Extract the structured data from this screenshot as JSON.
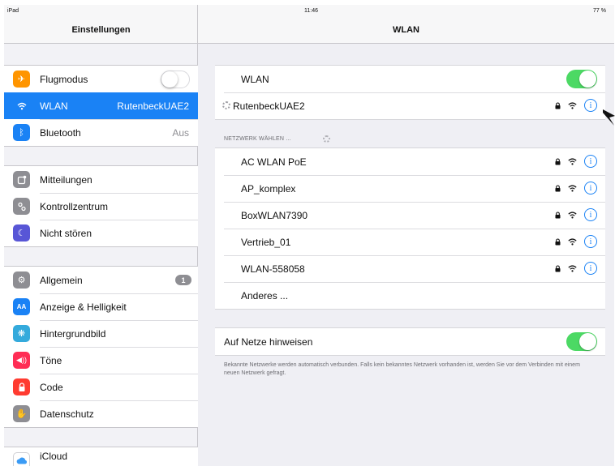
{
  "status": {
    "device": "iPad",
    "time": "11:46",
    "battery": "77 %"
  },
  "sidebar": {
    "title": "Einstellungen",
    "groups": [
      [
        {
          "label": "Flugmodus",
          "icon": "airplane-icon",
          "color": "#ff9500",
          "toggle": false
        },
        {
          "label": "WLAN",
          "icon": "wifi-icon",
          "color": "#1a82f5",
          "value": "RutenbeckUAE2",
          "selected": true
        },
        {
          "label": "Bluetooth",
          "icon": "bluetooth-icon",
          "color": "#1a82f5",
          "value": "Aus"
        }
      ],
      [
        {
          "label": "Mitteilungen",
          "icon": "notifications-icon",
          "color": "#8e8e93"
        },
        {
          "label": "Kontrollzentrum",
          "icon": "control-center-icon",
          "color": "#8e8e93"
        },
        {
          "label": "Nicht stören",
          "icon": "moon-icon",
          "color": "#5856d6"
        }
      ],
      [
        {
          "label": "Allgemein",
          "icon": "gear-icon",
          "color": "#8e8e93",
          "badge": "1"
        },
        {
          "label": "Anzeige & Helligkeit",
          "icon": "display-icon",
          "color": "#1a82f5"
        },
        {
          "label": "Hintergrundbild",
          "icon": "wallpaper-icon",
          "color": "#34aadc"
        },
        {
          "label": "Töne",
          "icon": "speaker-icon",
          "color": "#ff2d55"
        },
        {
          "label": "Code",
          "icon": "lock-icon",
          "color": "#ff3b30"
        },
        {
          "label": "Datenschutz",
          "icon": "hand-icon",
          "color": "#8e8e93"
        }
      ],
      [
        {
          "label": "iCloud",
          "icon": "cloud-icon",
          "color": "#ffffff"
        }
      ]
    ]
  },
  "detail": {
    "title": "WLAN",
    "wlan_label": "WLAN",
    "wlan_on": true,
    "connected_network": "RutenbeckUAE2",
    "section_header": "NETZWERK WÄHLEN ...",
    "networks": [
      "AC WLAN PoE",
      "AP_komplex",
      "BoxWLAN7390",
      "Vertrieb_01",
      "WLAN-558058"
    ],
    "other_label": "Anderes ...",
    "ask_label": "Auf Netze hinweisen",
    "ask_on": true,
    "footnote": "Bekannte Netzwerke werden automatisch verbunden. Falls kein bekanntes Netzwerk vorhanden ist, werden Sie vor dem Verbinden mit einem neuen Netzwerk gefragt."
  },
  "colors": {
    "accent": "#1a82f5",
    "toggle_on": "#4cd964"
  }
}
